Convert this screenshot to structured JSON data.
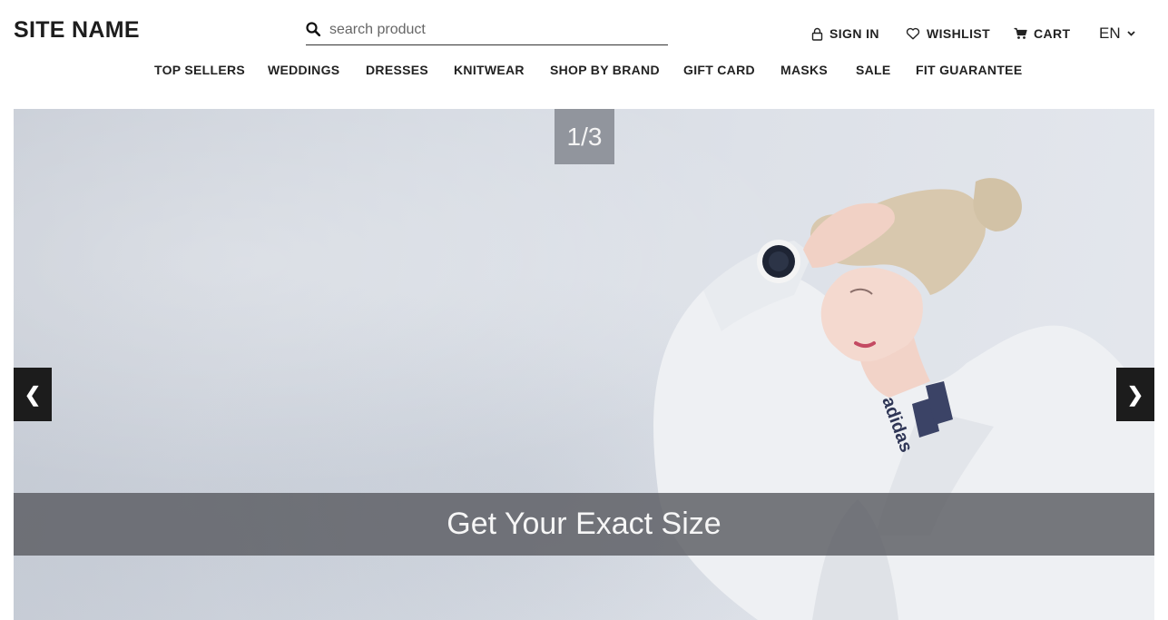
{
  "header": {
    "site_name": "SITE NAME",
    "search": {
      "placeholder": "search product",
      "value": ""
    },
    "account": {
      "sign_in": "SIGN IN",
      "wishlist": "WISHLIST",
      "cart": "CART",
      "language": "EN"
    }
  },
  "nav": {
    "items": [
      "TOP SELLERS",
      "WEDDINGS",
      "DRESSES",
      "KNITWEAR",
      "SHOP BY BRAND",
      "GIFT CARD",
      "MASKS",
      "SALE",
      "FIT GUARANTEE"
    ]
  },
  "hero": {
    "counter": "1/3",
    "prev_arrow": "❮",
    "next_arrow": "❯",
    "caption": "Get Your Exact Size",
    "brand_text": "adidas"
  },
  "colors": {
    "text": "#222222",
    "arrow_bg": "#1c1c1c",
    "caption_bg": "#5a5c62"
  }
}
